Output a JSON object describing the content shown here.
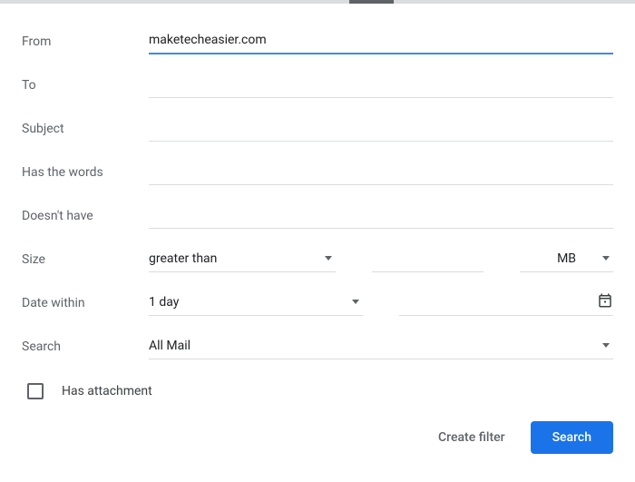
{
  "fields": {
    "from": {
      "label": "From",
      "value": "maketecheasier.com"
    },
    "to": {
      "label": "To",
      "value": ""
    },
    "subject": {
      "label": "Subject",
      "value": ""
    },
    "has_words": {
      "label": "Has the words",
      "value": ""
    },
    "doesnt_have": {
      "label": "Doesn't have",
      "value": ""
    },
    "size": {
      "label": "Size",
      "operator": "greater than",
      "amount": "",
      "unit": "MB"
    },
    "date_within": {
      "label": "Date within",
      "value": "1 day"
    },
    "search": {
      "label": "Search",
      "value": "All Mail"
    },
    "has_attachment": {
      "label": "Has attachment",
      "checked": false
    }
  },
  "footer": {
    "create_filter": "Create filter",
    "search": "Search"
  }
}
